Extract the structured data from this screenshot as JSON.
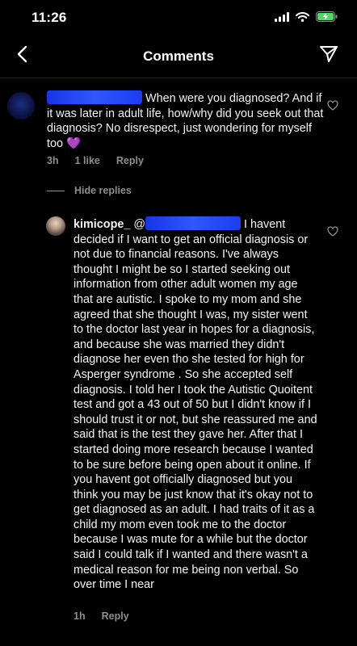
{
  "status_bar": {
    "time": "11:26"
  },
  "header": {
    "title": "Comments"
  },
  "comments": [
    {
      "text": "When were you diagnosed? And if it was later in adult life, how/why did you seek out that diagnosis?  No disrespect, just wondering for myself too 💜",
      "time": "3h",
      "likes": "1 like",
      "reply_label": "Reply"
    }
  ],
  "replies_toggle": {
    "label": "Hide replies"
  },
  "replies": [
    {
      "username": "kimicope_",
      "text_prefix": "@",
      "text": "I havent decided if I want to get an official diagnosis or not due to financial reasons. I've always thought I might be so I started seeking out information from other adult women my age that are autistic. I spoke to my mom and she agreed that she thought I was, my sister went to the doctor last year in hopes for a diagnosis, and because she was married they didn't diagnose her even tho she tested for high for Asperger syndrome . So she accepted self diagnosis. I told her I took the Autistic Quoitent test and got a 43 out of 50 but I didn't know if I should trust it or not, but she reassured me and said that is the test they gave her. After that I started doing more research because I wanted to be sure before being open about it online. If you havent got officially diagnosed but you think you may be just know that it's okay not to get diagnosed as an adult. I had traits of it as a child my mom even took me to the doctor because I was mute for a while but the doctor said I could talk if I wanted and there wasn't a medical reason for me being non verbal. So over time I near",
      "time": "1h",
      "reply_label": "Reply"
    }
  ]
}
